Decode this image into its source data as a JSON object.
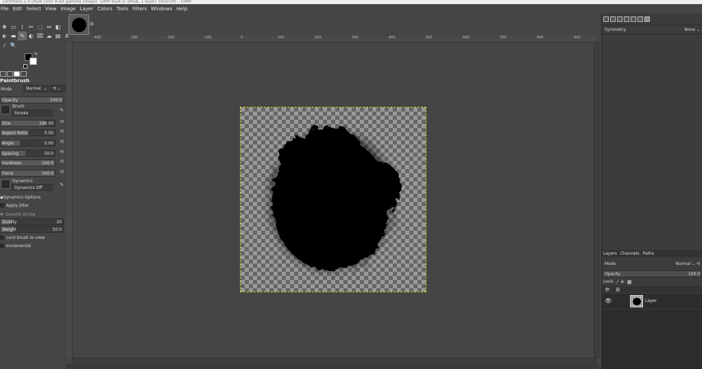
{
  "window": {
    "title": "[Untitled]-1.0 (RGB color 8-bit gamma integer, GIMP built-in sRGB, 1 layer) 500x500 – GIMP"
  },
  "menu": [
    "File",
    "Edit",
    "Select",
    "View",
    "Image",
    "Layer",
    "Colors",
    "Tools",
    "Filters",
    "Windows",
    "Help"
  ],
  "tools": {
    "row1": [
      "✥",
      "▭",
      "⟟",
      "✂",
      "⬚",
      "↔",
      "◧",
      "✒"
    ],
    "row2": [
      "⬖",
      "▬",
      "✎",
      "◐",
      "⌧",
      "☁",
      "▤",
      "A"
    ],
    "row3": [
      "⁄",
      "🔍"
    ]
  },
  "colors": {
    "foreground": "#000000",
    "background": "#ffffff"
  },
  "tool_options": {
    "title": "Paintbrush",
    "mode_label": "Mode",
    "mode_value": "Normal",
    "opacity_label": "Opacity",
    "opacity_value": "100.0",
    "brush_label": "Brush",
    "brush_value": "Smoke",
    "size_label": "Size",
    "size_value": "168.00",
    "aspect_label": "Aspect Ratio",
    "aspect_value": "0.00",
    "angle_label": "Angle",
    "angle_value": "0.00",
    "spacing_label": "Spacing",
    "spacing_value": "50.0",
    "hardness_label": "Hardness",
    "hardness_value": "100.0",
    "force_label": "Force",
    "force_value": "100.0",
    "dynamics_label": "Dynamics",
    "dynamics_value": "Dynamics Off",
    "dynamics_options": "Dynamics Options",
    "apply_jitter": "Apply Jitter",
    "smooth_stroke": "Smooth stroke",
    "quality_label": "Quality",
    "quality_value": "20",
    "weight_label": "Weight",
    "weight_value": "50.0",
    "lock_brush": "Lock brush to view",
    "incremental": "Incremental"
  },
  "ruler": {
    "h_labels": [
      "-400",
      "-300",
      "-200",
      "-100",
      "0",
      "100",
      "200",
      "300",
      "400",
      "500",
      "600",
      "700",
      "800",
      "900"
    ]
  },
  "dock": {
    "symmetry_label": "Symmetry",
    "symmetry_value": "None",
    "tabs": [
      "Layers",
      "Channels",
      "Paths"
    ],
    "mode_label": "Mode",
    "mode_value": "Normal",
    "opacity_label": "Opacity",
    "opacity_value": "100.0",
    "lock_label": "Lock:",
    "layer_name": "Layer"
  }
}
